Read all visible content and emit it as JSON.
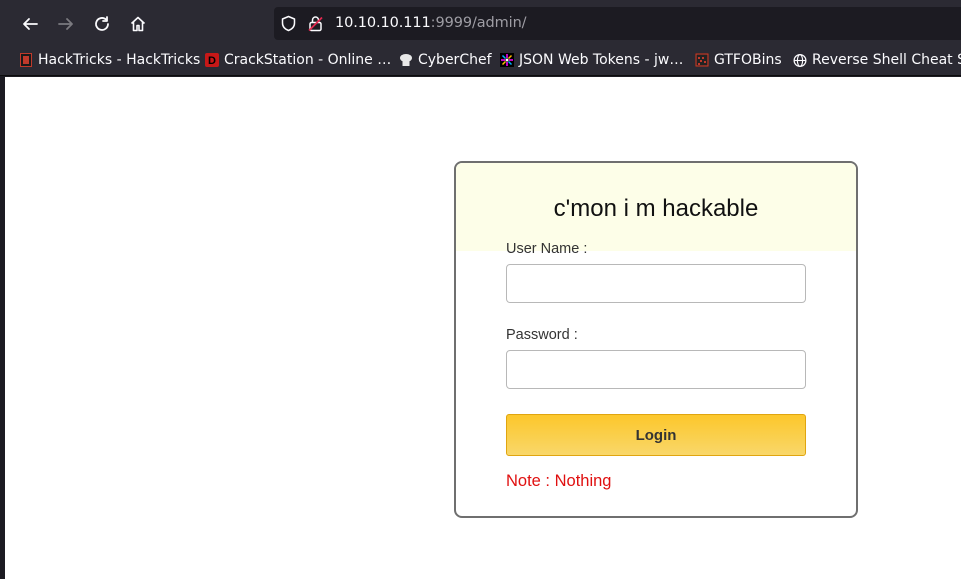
{
  "browser": {
    "url_host": "10.10.10.111",
    "url_path": ":9999/admin/",
    "colors": {
      "chrome": "#2b2a33",
      "urlbar": "#1c1b22"
    }
  },
  "bookmarks": [
    {
      "label": "HackTricks - HackTricks",
      "icon": "hacktricks-icon"
    },
    {
      "label": "CrackStation - Online …",
      "icon": "crackstation-icon"
    },
    {
      "label": "CyberChef",
      "icon": "cyberchef-icon"
    },
    {
      "label": "JSON Web Tokens - jw…",
      "icon": "jwt-icon"
    },
    {
      "label": "GTFOBins",
      "icon": "gtfobins-icon"
    },
    {
      "label": "Reverse Shell Cheat S…",
      "icon": "globe-icon"
    }
  ],
  "form": {
    "title": "c'mon i m hackable",
    "username_label": "User Name :",
    "username_value": "",
    "password_label": "Password :",
    "password_value": "",
    "login_label": "Login",
    "note": "Note : Nothing",
    "colors": {
      "header_bg": "#fdfee8",
      "button": "#fcc72b",
      "note": "#e01010"
    }
  }
}
